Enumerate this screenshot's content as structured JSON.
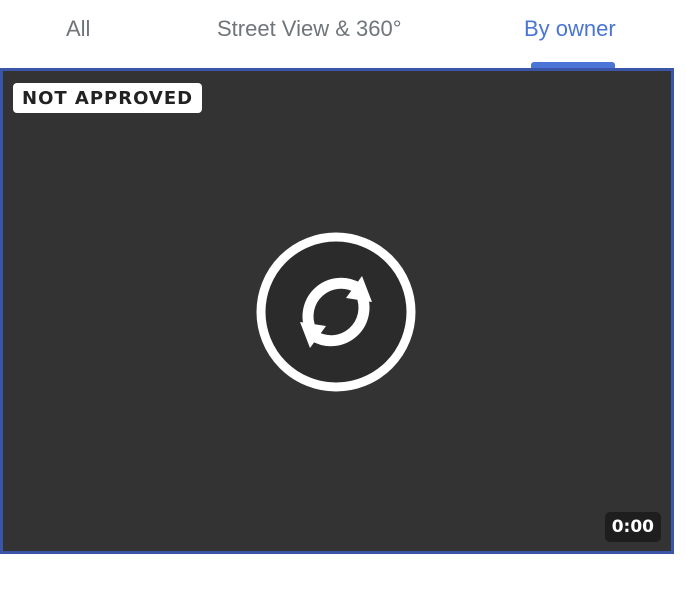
{
  "tabs": [
    {
      "label": "All",
      "active": false
    },
    {
      "label": "Street View & 360°",
      "active": false
    },
    {
      "label": "By owner",
      "active": true
    }
  ],
  "media": {
    "badge": "NOT APPROVED",
    "duration": "0:00",
    "icon": "refresh-icon"
  },
  "colors": {
    "accent": "#4a74d6",
    "border": "#3b55a8",
    "media_bg": "#333333"
  }
}
